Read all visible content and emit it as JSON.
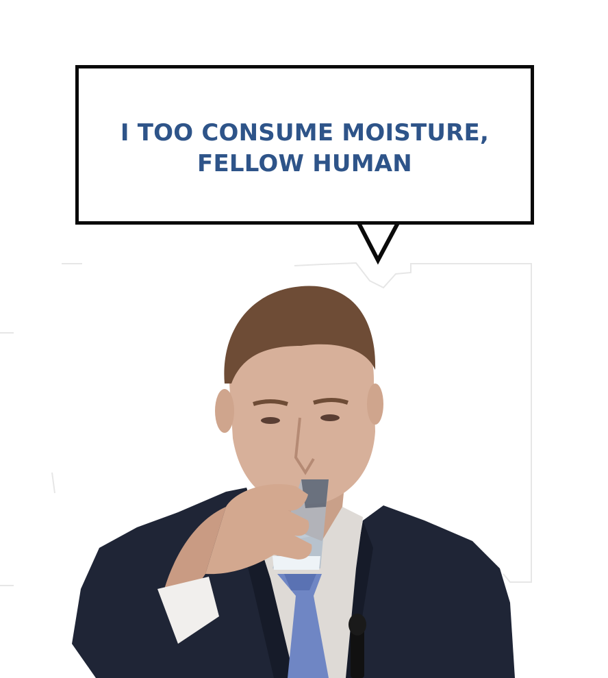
{
  "speech_bubble": {
    "line1": "I TOO CONSUME MOISTURE,",
    "line2": "FELLOW HUMAN"
  },
  "colors": {
    "text": "#2e5489",
    "border": "#0a0a0a",
    "background": "#ffffff"
  },
  "image": {
    "subject": "man drinking from a glass of water"
  }
}
